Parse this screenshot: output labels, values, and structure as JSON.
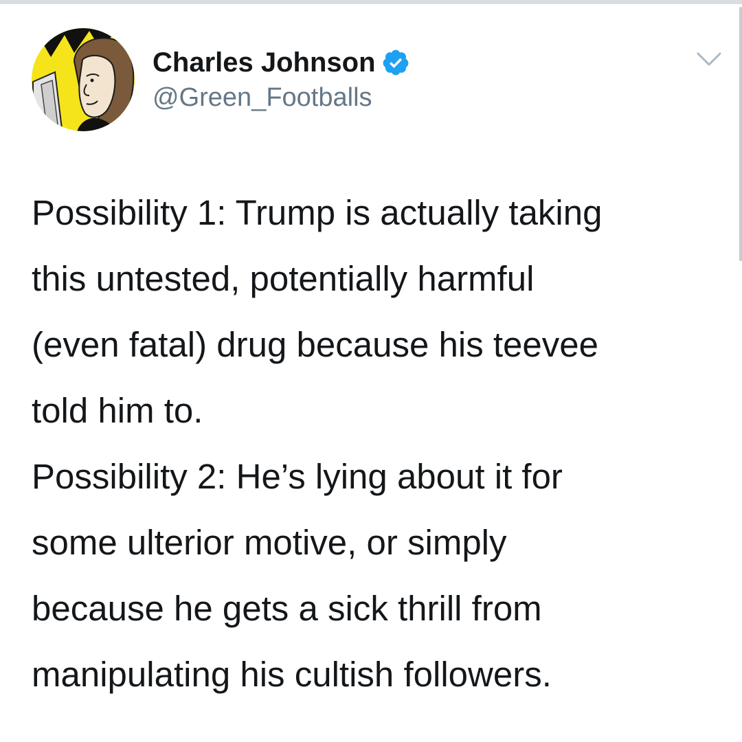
{
  "tweet": {
    "author": {
      "display_name": "Charles Johnson",
      "handle": "@Green_Footballs",
      "verified": true,
      "avatar_icon": "cartoon-portrait-avatar"
    },
    "menu_icon": "chevron-down-icon",
    "paragraphs": [
      "Possibility 1: Trump is actually taking\nthis untested, potentially harmful\n(even fatal) drug because his teevee\ntold him to.",
      "Possibility 2: He’s lying about it for\nsome ulterior motive, or simply\nbecause he gets a sick thrill from\nmanipulating his cultish followers."
    ]
  },
  "colors": {
    "text_primary": "#14171a",
    "text_secondary": "#657786",
    "verified_blue": "#1da1f2",
    "avatar_yellow": "#f5e41a"
  }
}
